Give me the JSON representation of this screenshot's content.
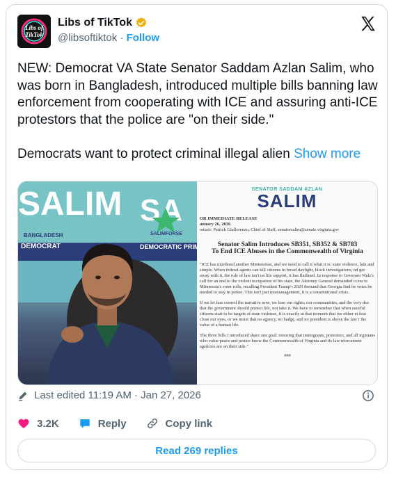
{
  "author": {
    "name": "Libs of TikTok",
    "handle": "@libsoftiktok",
    "follow_label": "Follow",
    "avatar_text_top": "Libs of",
    "avatar_text_bottom": "TikTok"
  },
  "tweet": {
    "text": "NEW: Democrat VA State Senator Saddam Azlan Salim, who was born in Bangladesh, introduced multiple bills banning law enforcement from cooperating with ICE and assuring anti-ICE protestors that the police are \"on their side.\"\n\nDemocrats want to protect criminal illegal alien ",
    "show_more_label": "Show more"
  },
  "media": {
    "photo": {
      "banner_text": "SALIM",
      "banner_subtext": "DEMOCRAT",
      "banner_subtext_2": "DEMOCRATIC PRIM",
      "banner_subtext_3": "BANGLADESH",
      "banner_subtext_4": "SALIMFORSE"
    },
    "document": {
      "header_small": "SENATOR SADDAM AZLAN",
      "header_big": "SALIM",
      "release_line": "OR IMMEDIATE RELEASE",
      "date_line": "anuary 26, 2026",
      "contact_line": "ontact: Patrick Giallorenzo, Chief of Staff, senatorsalim@senate.virginia.gov",
      "title_line_1": "Senator Salim Introduces SB351, SB352 & SB783",
      "title_line_2": "To End ICE Abuses in the Commonwealth of Virginia",
      "para_1": "\"ICE has murdered another Minnesotan, and we need to call it what it is: state violence, lain and simple. When federal agents can kill citizens in broad daylight, block investigations, nd get away with it, the rule of law isn't on life support, it has flatlined. In response to Governor Walz's call for an end to the violent occupation of his state, the Attorney General demanded ccess to Minnesota's voter rolls, recalling President Trump's 2020 demand that Georgia find he votes he needed to stay in power. This isn't just mismanagement, it is a constitutional crisis.",
      "para_2": "If we let fear control the narrative now, we lose our rights, our communities, and the very dea that the government should protect life, not take it. We have to remember that when eaceful citizens start to be targets of state violence, it is exactly at that moment that we either et fear close our eyes, or we insist that no agency, no badge, and no president is above the law r the value of a human life.",
      "para_3": "The three bills I introduced share one goal: ensuring that immigrants, protesters, and all irginians who value peace and justice know the Commonwealth of Virginia and its law nforcement agencies are on their side.\"",
      "end_mark": "###"
    }
  },
  "meta": {
    "last_edited": "Last edited 11:19 AM · Jan 27, 2026"
  },
  "actions": {
    "like_count": "3.2K",
    "reply_label": "Reply",
    "copy_link_label": "Copy link"
  },
  "read_replies_label": "Read 269 replies",
  "colors": {
    "accent": "#1d9bf0",
    "like": "#f91880",
    "muted": "#536471",
    "verified": "#e8b10e"
  }
}
